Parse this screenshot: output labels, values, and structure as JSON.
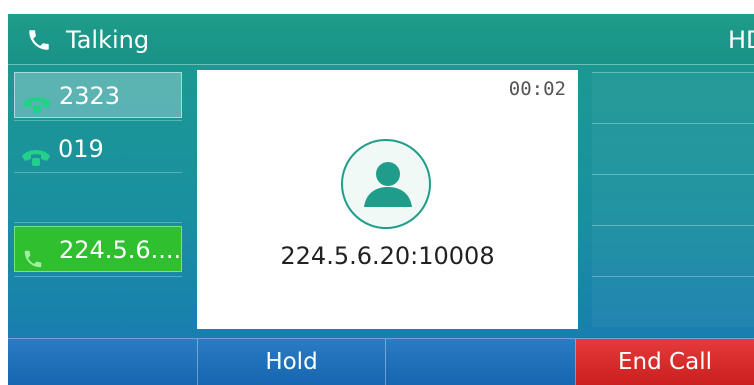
{
  "header": {
    "title": "Talking",
    "badge": "HD"
  },
  "line_keys": [
    {
      "label": "2323",
      "icon": "phone-handset-icon",
      "state": "selected"
    },
    {
      "label": "019",
      "icon": "phone-handset-icon",
      "state": "idle"
    },
    {
      "label": "224.5.6....",
      "icon": "active-call-icon",
      "state": "active"
    }
  ],
  "call": {
    "duration": "00:02",
    "remote_number": "224.5.6.20:10008",
    "avatar_icon": "contact-avatar-icon"
  },
  "softkeys": [
    {
      "label": ""
    },
    {
      "label": "Hold"
    },
    {
      "label": ""
    },
    {
      "label": "End Call"
    }
  ],
  "colors": {
    "header": "#1f9c8a",
    "active_line": "#2fbf2f",
    "end_call": "#d32a2a",
    "softkey_bar": "#1b6fb8"
  }
}
